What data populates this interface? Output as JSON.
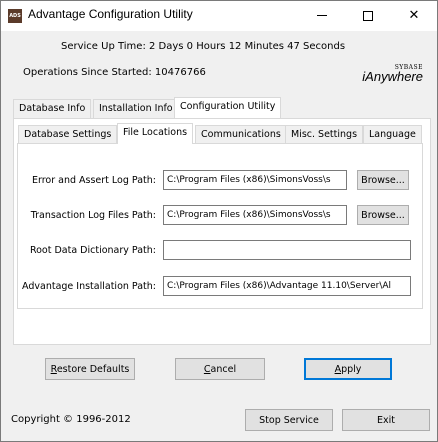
{
  "window": {
    "title": "Advantage Configuration Utility",
    "app_icon_text": "ADS"
  },
  "status": {
    "uptime": "Service Up Time:  2 Days 0 Hours 12 Minutes 47 Seconds",
    "operations": "Operations Since Started: 10476766"
  },
  "logo": {
    "line1": "SYBASE",
    "line2": "iAnywhere"
  },
  "main_tabs": [
    {
      "label": "Database Info"
    },
    {
      "label": "Installation Info"
    },
    {
      "label": "Configuration Utility"
    }
  ],
  "sub_tabs": [
    {
      "label": "Database Settings"
    },
    {
      "label": "File Locations"
    },
    {
      "label": "Communications"
    },
    {
      "label": "Misc. Settings"
    },
    {
      "label": "Language"
    }
  ],
  "fields": {
    "error_log": {
      "label": "Error and Assert Log Path:",
      "value": "C:\\Program Files (x86)\\SimonsVoss\\s"
    },
    "tx_log": {
      "label": "Transaction Log Files Path:",
      "value": "C:\\Program Files (x86)\\SimonsVoss\\s"
    },
    "root_dd": {
      "label": "Root Data Dictionary Path:",
      "value": ""
    },
    "install": {
      "label": "Advantage Installation Path:",
      "value": "C:\\Program Files (x86)\\Advantage 11.10\\Server\\Al"
    }
  },
  "buttons": {
    "browse": "Browse...",
    "restore_r": "R",
    "restore_rest": "estore Defaults",
    "cancel_c": "C",
    "cancel_rest": "ancel",
    "apply_a": "A",
    "apply_rest": "pply",
    "stop_service": "Stop Service",
    "exit": "Exit"
  },
  "footer": {
    "copyright": "Copyright © 1996-2012"
  }
}
